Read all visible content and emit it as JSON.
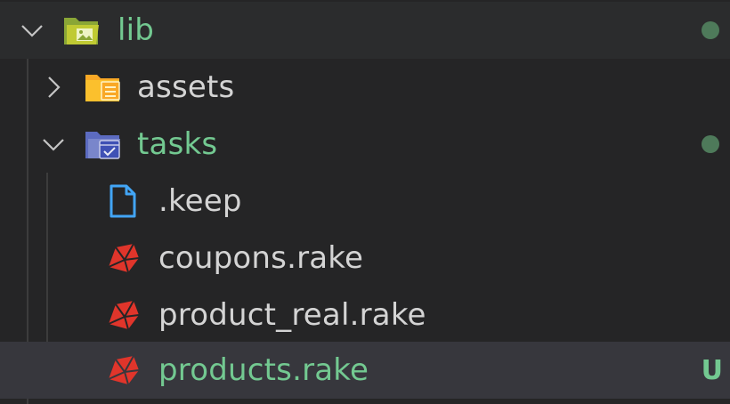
{
  "tree": {
    "lib": {
      "label": "lib",
      "expanded": true,
      "git_status": "modified-dot"
    },
    "assets": {
      "label": "assets",
      "expanded": false
    },
    "tasks": {
      "label": "tasks",
      "expanded": true,
      "git_status": "modified-dot"
    },
    "files": [
      {
        "label": ".keep",
        "icon": "file-icon"
      },
      {
        "label": "coupons.rake",
        "icon": "ruby-icon"
      },
      {
        "label": "product_real.rake",
        "icon": "ruby-icon"
      },
      {
        "label": "products.rake",
        "icon": "ruby-icon",
        "selected": true,
        "git_status": "U"
      }
    ]
  },
  "colors": {
    "background": "#252526",
    "selected_row": "#37373d",
    "untracked_text": "#73c991",
    "plain_text": "#d4d4d4",
    "status_dot": "#4e7a5a",
    "ruby_red": "#e0352b"
  }
}
